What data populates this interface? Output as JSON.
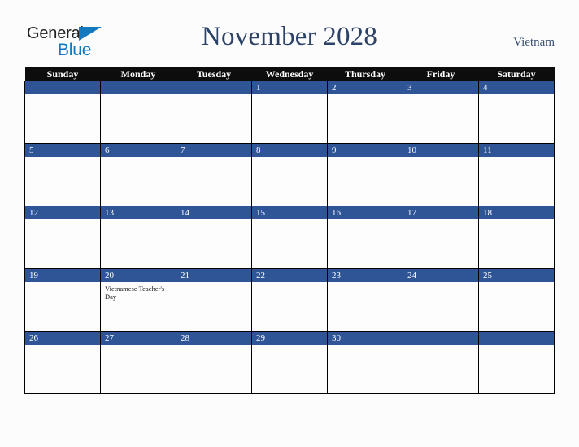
{
  "brand": {
    "name_part1": "General",
    "name_part2": "Blue",
    "triangle_icon": "triangle-icon",
    "accent_color": "#1279bf"
  },
  "header": {
    "title": "November 2028",
    "country": "Vietnam",
    "title_color": "#2c4268"
  },
  "calendar": {
    "header_background": "#0d0d0d",
    "date_band_color": "#2f5597",
    "cell_background": "#fdfdfd",
    "weekdays": [
      "Sunday",
      "Monday",
      "Tuesday",
      "Wednesday",
      "Thursday",
      "Friday",
      "Saturday"
    ],
    "weeks": [
      [
        {
          "day": "",
          "events": []
        },
        {
          "day": "",
          "events": []
        },
        {
          "day": "",
          "events": []
        },
        {
          "day": "1",
          "events": []
        },
        {
          "day": "2",
          "events": []
        },
        {
          "day": "3",
          "events": []
        },
        {
          "day": "4",
          "events": []
        }
      ],
      [
        {
          "day": "5",
          "events": []
        },
        {
          "day": "6",
          "events": []
        },
        {
          "day": "7",
          "events": []
        },
        {
          "day": "8",
          "events": []
        },
        {
          "day": "9",
          "events": []
        },
        {
          "day": "10",
          "events": []
        },
        {
          "day": "11",
          "events": []
        }
      ],
      [
        {
          "day": "12",
          "events": []
        },
        {
          "day": "13",
          "events": []
        },
        {
          "day": "14",
          "events": []
        },
        {
          "day": "15",
          "events": []
        },
        {
          "day": "16",
          "events": []
        },
        {
          "day": "17",
          "events": []
        },
        {
          "day": "18",
          "events": []
        }
      ],
      [
        {
          "day": "19",
          "events": []
        },
        {
          "day": "20",
          "events": [
            "Vietnamese Teacher's Day"
          ]
        },
        {
          "day": "21",
          "events": []
        },
        {
          "day": "22",
          "events": []
        },
        {
          "day": "23",
          "events": []
        },
        {
          "day": "24",
          "events": []
        },
        {
          "day": "25",
          "events": []
        }
      ],
      [
        {
          "day": "26",
          "events": []
        },
        {
          "day": "27",
          "events": []
        },
        {
          "day": "28",
          "events": []
        },
        {
          "day": "29",
          "events": []
        },
        {
          "day": "30",
          "events": []
        },
        {
          "day": "",
          "events": []
        },
        {
          "day": "",
          "events": []
        }
      ]
    ]
  }
}
